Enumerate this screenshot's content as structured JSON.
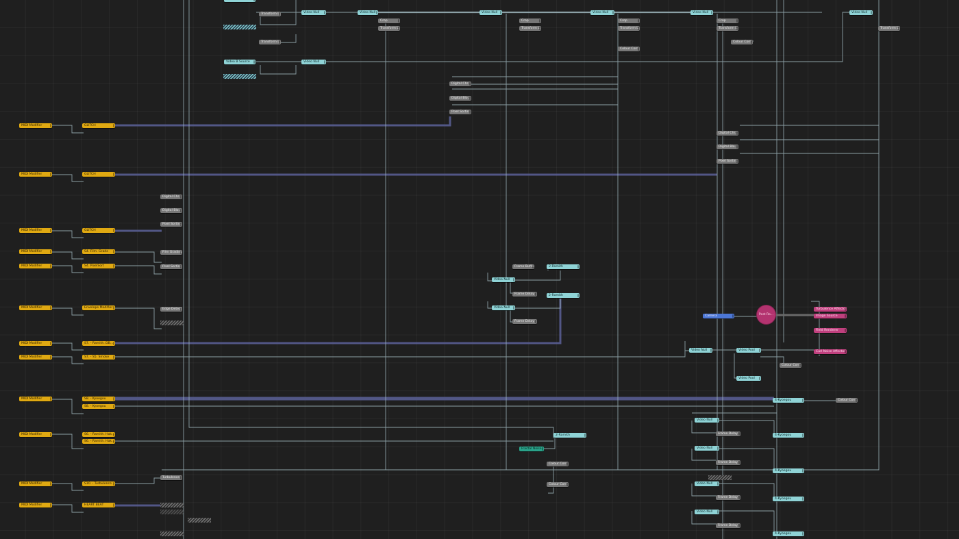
{
  "canvas": {
    "nodes": {
      "midi_1": "MIDI Modifier",
      "midi_2": "MIDI Modifier",
      "midi_3": "MIDI Modifier",
      "midi_4": "MIDI Modifier",
      "midi_5": "MIDI Modifier",
      "midi_6": "MIDI Modifier",
      "midi_7": "MIDI Modifier",
      "midi_8": "MIDI Modifier",
      "midi_9": "MIDI Modifier",
      "midi_10": "MIDI Modifier",
      "midi_11": "MIDI Modifier",
      "midi_12": "MIDI Modifier",
      "glitch_1": "GLITCH",
      "glitch_2": "GLITCH",
      "glitch_3": "GLITCH",
      "film_grade": "S4. Film. Grade",
      "pixelsort": "S4. PixelSort",
      "envelope": "Envelope Modifier",
      "ramith_db": "S7. - Ramith. DB...",
      "s5_smoke": "S7. - S5. Smoke",
      "kyoegou_1": "S8. - Kyoegou",
      "kyoegou_2": "S8. - Kyoegou",
      "ramith_hak_1": "S6. - Ramith. Hak...",
      "ramith_hak_2": "S6. - Ramith. Hak...",
      "turbulence_mod": "S10. - Turbulence",
      "heart_beat": "HEART BEAT",
      "transform_a": "Transform L...",
      "transform_b": "Transform L...",
      "video_b_source": "Video B Source",
      "video_null_top1": "Video Null",
      "video_null_top2": "Video Null",
      "video_null_top3": "Video Null",
      "video_null_top4": "Video Null",
      "video_null_top5": "Video Null",
      "video_null_top6": "Video Null",
      "video_null_top7": "Video Null",
      "video_null_b": "Video Null",
      "crop_1": "Crop",
      "transform_c1": "Transform L...",
      "crop_2": "Crop",
      "transform_c2": "Transform L...",
      "crop_3": "Crop",
      "transform_c3": "Transform L...",
      "colour_corr_1": "Colour Corr...",
      "crop_4": "Crop",
      "transform_c4": "Transform L...",
      "colour_corr_2": "Colour Corr...",
      "transform_c5": "Transform L...",
      "digital_chr_1": "Digital Chr...",
      "digital_blo_1": "Digital Blo...",
      "pixel_sort_1": "Pixel Sortin...",
      "digital_chr_2": "Digital Chr...",
      "digital_blo_2": "Digital Blo...",
      "pixel_sort_2": "Pixel Sortin...",
      "digital_chr_3": "Digital Chr...",
      "digital_blo_3": "Digital Blo...",
      "pixel_sort_3": "Pixel Sortin...",
      "film_grading": "Film Grading",
      "pixel_sort_4": "Pixel Sortin...",
      "edge_detect": "Edge Detect",
      "turbulence": "Turbulence",
      "frame_buffer": "Frame Buffer",
      "ramith_2a": "2-Ramith",
      "ramith_2b": "2-Ramith",
      "video_null_m1": "Video Null",
      "frame_delay_m1": "Frame Delay",
      "video_null_m2": "Video Null",
      "frame_delay_m2": "Frame Delay",
      "camera": "Camera",
      "post_fx": "Post Ro...",
      "turbulence_affector": "Turbulence Affector",
      "image_source": "Image Source",
      "field_renderer": "Field Renderer",
      "curl_noise": "Curl Noise Affector",
      "video_null_r1": "Video Null",
      "video_pool_r1": "Video Pool",
      "colour_corr_r1": "Colour Corr...",
      "video_pool_r2": "Video Pool",
      "kyoegou_4a": "4-Kyoegou",
      "colour_corr_r2": "Colour Corr...",
      "ramith_2c": "2-Ramith",
      "fractal_noise": "Fractal Noise",
      "colour_corr_m3": "Colour Corr...",
      "colour_corr_m4": "Colour Corr...",
      "video_null_b1": "Video Null",
      "frame_delay_b1": "Frame Delay",
      "video_null_b2": "Video Null",
      "frame_delay_b2": "Frame Delay",
      "kyoegou_4b": "4-Kyoegou",
      "kyoegou_4c": "4-Kyoegou",
      "video_null_b3": "Video Null",
      "frame_delay_b3": "Frame Delay",
      "kyoegou_4d": "4-Kyoegou",
      "video_null_b4": "Video Null",
      "frame_delay_b4": "Frame Delay",
      "kyoegou_4e": "4-Kyoegou"
    }
  },
  "colors": {
    "background": "#1f1f1f",
    "wire": "#9fb7be",
    "wire_thick": "#555a8c",
    "modifier_node": "#e0a912",
    "generic_node": "#777777",
    "video_node": "#8fd3d6",
    "camera_node": "#4c77d6",
    "particle_node": "#c0407e"
  }
}
